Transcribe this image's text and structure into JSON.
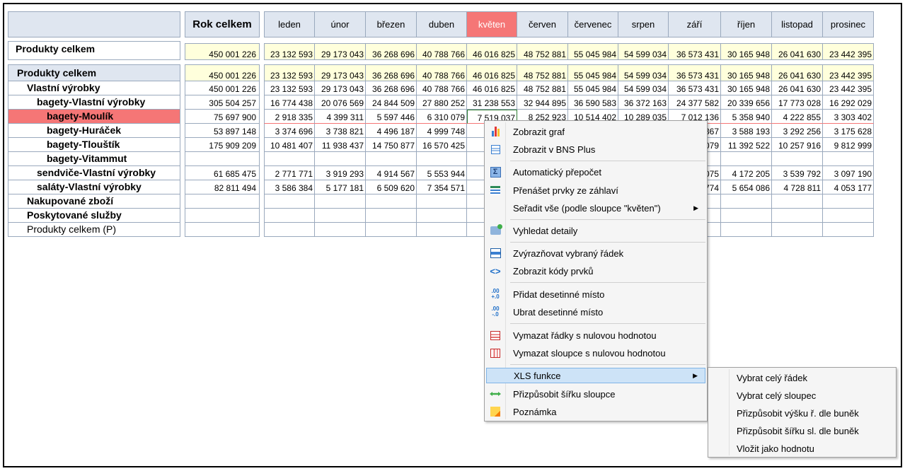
{
  "header": {
    "total_label": "Rok celkem",
    "months": [
      "leden",
      "únor",
      "březen",
      "duben",
      "květen",
      "červen",
      "červenec",
      "srpen",
      "září",
      "říjen",
      "listopad",
      "prosinec"
    ],
    "selected_month_index": 4
  },
  "top_row": {
    "label": "Produkty celkem",
    "total": "450 001 226",
    "values": [
      "23 132 593",
      "29 173 043",
      "36 268 696",
      "40 788 766",
      "46 016 825",
      "48 752 881",
      "55 045 984",
      "54 599 034",
      "36 573 431",
      "30 165 948",
      "26 041 630",
      "23 442 395"
    ]
  },
  "rows": [
    {
      "label": "Produkty celkem",
      "total": "450 001 226",
      "values": [
        "23 132 593",
        "29 173 043",
        "36 268 696",
        "40 788 766",
        "46 016 825",
        "48 752 881",
        "55 045 984",
        "54 599 034",
        "36 573 431",
        "30 165 948",
        "26 041 630",
        "23 442 395"
      ]
    },
    {
      "label": "Vlastní výrobky",
      "total": "450 001 226",
      "values": [
        "23 132 593",
        "29 173 043",
        "36 268 696",
        "40 788 766",
        "46 016 825",
        "48 752 881",
        "55 045 984",
        "54 599 034",
        "36 573 431",
        "30 165 948",
        "26 041 630",
        "23 442 395"
      ]
    },
    {
      "label": "bagety-Vlastní výrobky",
      "total": "305 504 257",
      "values": [
        "16 774 438",
        "20 076 569",
        "24 844 509",
        "27 880 252",
        "31 238 553",
        "32 944 895",
        "36 590 583",
        "36 372 163",
        "24 377 582",
        "20 339 656",
        "17 773 028",
        "16 292 029"
      ]
    },
    {
      "label": "bagety-Moulík",
      "total": "75 697 900",
      "values": [
        "2 918 335",
        "4 399 311",
        "5 597 446",
        "6 310 079",
        "7 519 037",
        "8 252 923",
        "10 514 402",
        "10 289 035",
        "7 012 136",
        "5 358 940",
        "4 222 855",
        "3 303 402"
      ]
    },
    {
      "label": "bagety-Huráček",
      "total": "53 897 148",
      "values": [
        "3 374 696",
        "3 738 821",
        "4 496 187",
        "4 999 748",
        "5",
        "",
        "",
        "",
        "367",
        "3 588 193",
        "3 292 256",
        "3 175 628"
      ]
    },
    {
      "label": "bagety-Tlouštík",
      "total": "175 909 209",
      "values": [
        "10 481 407",
        "11 938 437",
        "14 750 877",
        "16 570 425",
        "18",
        "",
        "",
        "",
        "079",
        "11 392 522",
        "10 257 916",
        "9 812 999"
      ]
    },
    {
      "label": "bagety-Vitammut",
      "total": "",
      "values": [
        "",
        "",
        "",
        "",
        "",
        "",
        "",
        "",
        "",
        "",
        "",
        ""
      ]
    },
    {
      "label": "sendviče-Vlastní výrobky",
      "total": "61 685 475",
      "values": [
        "2 771 771",
        "3 919 293",
        "4 914 567",
        "5 553 944",
        "6",
        "",
        "",
        "",
        "075",
        "4 172 205",
        "3 539 792",
        "3 097 190"
      ]
    },
    {
      "label": "saláty-Vlastní výrobky",
      "total": "82 811 494",
      "values": [
        "3 586 384",
        "5 177 181",
        "6 509 620",
        "7 354 571",
        "8",
        "",
        "",
        "",
        "774",
        "5 654 086",
        "4 728 811",
        "4 053 177"
      ]
    },
    {
      "label": "Nakupované zboží",
      "total": "",
      "values": [
        "",
        "",
        "",
        "",
        "",
        "",
        "",
        "",
        "",
        "",
        "",
        ""
      ]
    },
    {
      "label": "Poskytované služby",
      "total": "",
      "values": [
        "",
        "",
        "",
        "",
        "",
        "",
        "",
        "",
        "",
        "",
        "",
        ""
      ]
    },
    {
      "label": "Produkty celkem (P)",
      "total": "",
      "values": [
        "",
        "",
        "",
        "",
        "",
        "",
        "",
        "",
        "",
        "",
        "",
        ""
      ]
    }
  ],
  "context_menu": {
    "items": [
      {
        "label": "Zobrazit graf",
        "icon": "bar-chart-icon"
      },
      {
        "label": "Zobrazit v BNS Plus",
        "icon": "document-icon"
      },
      {
        "label": "Automatický přepočet",
        "icon": "sigma-icon"
      },
      {
        "label": "Přenášet prvky ze záhlaví",
        "icon": "header-transfer-icon"
      },
      {
        "label": "Seřadit vše (podle sloupce \"květen\")",
        "icon": "",
        "submenu": true
      },
      {
        "label": "Vyhledat detaily",
        "icon": "search-details-icon"
      },
      {
        "label": "Zvýrazňovat vybraný řádek",
        "icon": "highlight-row-icon"
      },
      {
        "label": "Zobrazit kódy prvků",
        "icon": "code-icon"
      },
      {
        "label": "Přidat desetinné místo",
        "icon": "add-decimal-icon"
      },
      {
        "label": "Ubrat desetinné místo",
        "icon": "remove-decimal-icon"
      },
      {
        "label": "Vymazat řádky s nulovou hodnotou",
        "icon": "delete-rows-icon"
      },
      {
        "label": "Vymazat sloupce s nulovou hodnotou",
        "icon": "delete-columns-icon"
      },
      {
        "label": "XLS funkce",
        "icon": "",
        "submenu": true
      },
      {
        "label": "Přizpůsobit šířku sloupce",
        "icon": "column-width-icon"
      },
      {
        "label": "Poznámka",
        "icon": "note-icon"
      }
    ]
  },
  "submenu": {
    "items": [
      "Vybrat celý řádek",
      "Vybrat celý sloupec",
      "Přizpůsobit výšku ř. dle buněk",
      "Přizpůsobit šířku sl. dle buněk",
      "Vložit jako hodnotu"
    ]
  },
  "colors": {
    "selected": "#f57676",
    "header_bg": "#dfe6f0",
    "total_bg": "#ffffdc",
    "menu_hover": "#cde3f7"
  }
}
